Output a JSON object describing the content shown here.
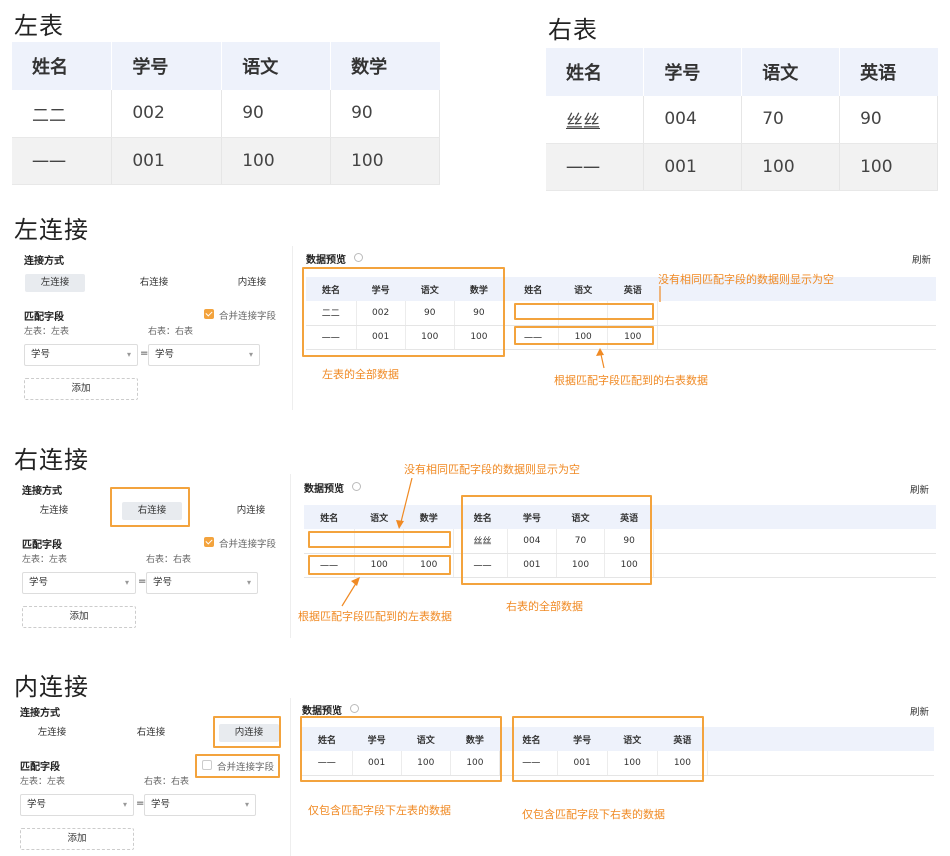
{
  "headings": {
    "left_table": "左表",
    "right_table": "右表",
    "left_join": "左连接",
    "right_join": "右连接",
    "inner_join": "内连接"
  },
  "left_table": {
    "columns": [
      "姓名",
      "学号",
      "语文",
      "数学"
    ],
    "rows": [
      [
        "二二",
        "002",
        "90",
        "90"
      ],
      [
        "一一",
        "001",
        "100",
        "100"
      ]
    ]
  },
  "right_table": {
    "columns": [
      "姓名",
      "学号",
      "语文",
      "英语"
    ],
    "rows": [
      [
        "丝丝",
        "004",
        "70",
        "90"
      ],
      [
        "一一",
        "001",
        "100",
        "100"
      ]
    ]
  },
  "config": {
    "join_mode_label": "连接方式",
    "modes": [
      "左连接",
      "右连接",
      "内连接"
    ],
    "match_field_label": "匹配字段",
    "merge_label": "合并连接字段",
    "left_side": "左表：左表",
    "right_side": "右表：右表",
    "left_select": "学号",
    "right_select": "学号",
    "eq": "=",
    "add_button": "添加",
    "arrow": "▾"
  },
  "preview": {
    "title": "数据预览",
    "refresh": "刷新"
  },
  "left_join": {
    "left_cols": [
      "姓名",
      "学号",
      "语文",
      "数学"
    ],
    "left_rows": [
      [
        "二二",
        "002",
        "90",
        "90"
      ],
      [
        "一一",
        "001",
        "100",
        "100"
      ]
    ],
    "right_cols": [
      "姓名",
      "语文",
      "英语"
    ],
    "right_rows": [
      [
        "",
        "",
        ""
      ],
      [
        "一一",
        "100",
        "100"
      ]
    ],
    "notes": {
      "empty": "没有相同匹配字段的数据则显示为空",
      "left_all": "左表的全部数据",
      "matched": "根据匹配字段匹配到的右表数据"
    }
  },
  "right_join": {
    "left_cols": [
      "姓名",
      "语文",
      "数学"
    ],
    "left_rows": [
      [
        "",
        "",
        ""
      ],
      [
        "一一",
        "100",
        "100"
      ]
    ],
    "right_cols": [
      "姓名",
      "学号",
      "语文",
      "英语"
    ],
    "right_rows": [
      [
        "丝丝",
        "004",
        "70",
        "90"
      ],
      [
        "一一",
        "001",
        "100",
        "100"
      ]
    ],
    "notes": {
      "empty": "没有相同匹配字段的数据则显示为空",
      "matched": "根据匹配字段匹配到的左表数据",
      "right_all": "右表的全部数据"
    }
  },
  "inner_join": {
    "left_cols": [
      "姓名",
      "学号",
      "语文",
      "数学"
    ],
    "left_rows": [
      [
        "一一",
        "001",
        "100",
        "100"
      ]
    ],
    "right_cols": [
      "姓名",
      "学号",
      "语文",
      "英语"
    ],
    "right_rows": [
      [
        "一一",
        "001",
        "100",
        "100"
      ]
    ],
    "notes": {
      "left_only": "仅包含匹配字段下左表的数据",
      "right_only": "仅包含匹配字段下右表的数据"
    }
  },
  "colors": {
    "accent": "#f3a33d",
    "note": "#f08a24",
    "header_bg": "#eef2fb"
  }
}
